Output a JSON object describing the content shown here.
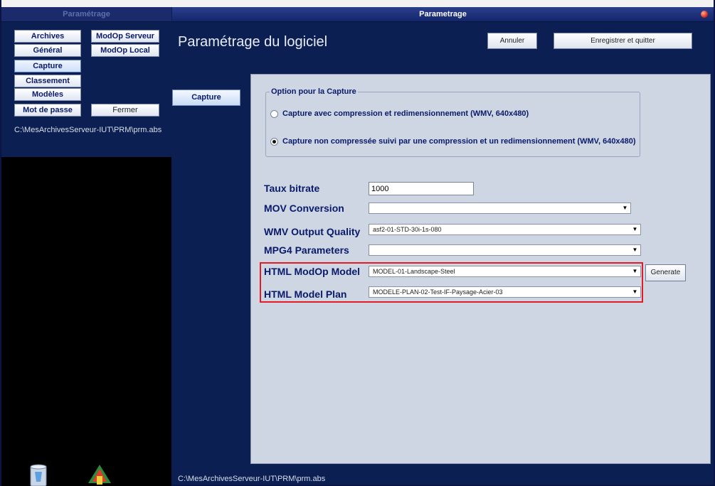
{
  "window": {
    "left_title": "Paramétrage",
    "title": "Parametrage"
  },
  "nav": {
    "archives": "Archives",
    "general": "Général",
    "capture": "Capture",
    "classement": "Classement",
    "modeles": "Modèles",
    "mot_de_passe": "Mot de passe",
    "modop_serveur": "ModOp Serveur",
    "modop_local": "ModOp Local",
    "fermer": "Fermer"
  },
  "left_path": "C:\\MesArchivesServeur-IUT\\PRM\\prm.abs",
  "main": {
    "title": "Paramétrage du logiciel",
    "cancel_label": "Annuler",
    "save_quit_label": "Enregistrer et quitter",
    "tab_capture": "Capture"
  },
  "capture_options": {
    "group_title": "Option pour la Capture",
    "option1": "Capture avec compression et redimensionnement (WMV, 640x480)",
    "option2": "Capture non compressée suivi par une compression et un redimensionnement (WMV, 640x480)",
    "selected": "option2"
  },
  "fields": {
    "taux_bitrate_label": "Taux bitrate",
    "taux_bitrate_value": "1000",
    "mov_conversion_label": "MOV Conversion",
    "mov_conversion_value": "",
    "wmv_quality_label": "WMV Output Quality",
    "wmv_quality_value": "asf2-01-STD-30i-1s-080",
    "mpg4_label": "MPG4 Parameters",
    "mpg4_value": "",
    "html_modop_label": "HTML ModOp Model",
    "html_modop_value": "MODEL-01-Landscape-Steel",
    "html_plan_label": "HTML Model Plan",
    "html_plan_value": "MODELE-PLAN-02-Test-IF-Paysage-Acier-03",
    "generate_label": "Generate"
  },
  "bottom_path": "C:\\MesArchivesServeur-IUT\\PRM\\prm.abs",
  "colors": {
    "background": "#0c1f52",
    "panel": "#cdd6e2",
    "label_text": "#0a1a6a",
    "highlight": "#e21b24"
  }
}
